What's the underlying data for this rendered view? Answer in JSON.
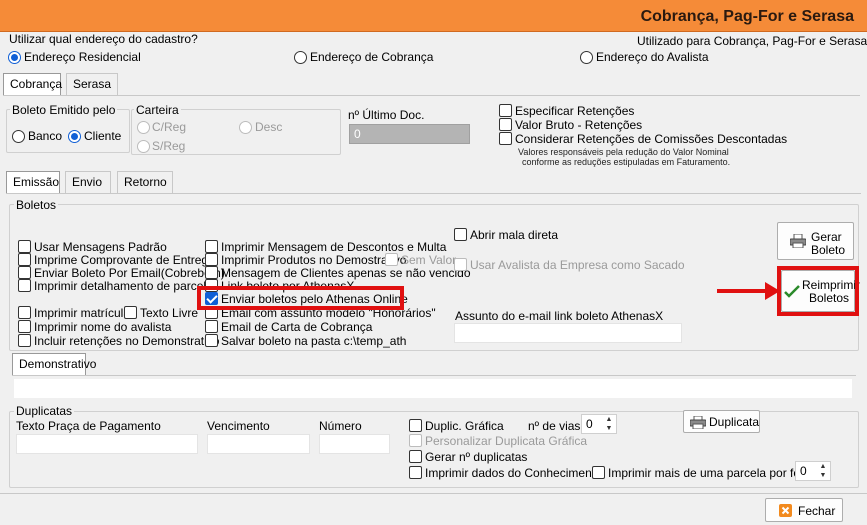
{
  "window": {
    "title": "Cobrança, Pag-For e Serasa"
  },
  "address": {
    "question": "Utilizar qual endereço do cadastro?",
    "note": "Utilizado para Cobrança, Pag-For e Serasa",
    "options": [
      "Endereço Residencial",
      "Endereço de Cobrança",
      "Endereço do Avalista"
    ],
    "selected": "Endereço Residencial"
  },
  "top_tabs": [
    "Cobrança",
    "Serasa"
  ],
  "boleto_emitido": {
    "title": "Boleto Emitido pelo",
    "options": [
      "Banco",
      "Cliente"
    ],
    "selected": "Cliente"
  },
  "carteira": {
    "title": "Carteira",
    "options": [
      "C/Reg",
      "Desc",
      "S/Reg"
    ]
  },
  "ultimo_doc": {
    "label": "nº Último Doc.",
    "value": "0"
  },
  "retencoes": {
    "items": [
      "Especificar Retenções",
      "Valor Bruto - Retenções",
      "Considerar Retenções de Comissões Descontadas"
    ],
    "note_line1": "Valores responsáveis pela redução do Valor Nominal",
    "note_line2": "conforme as reduções estipuladas em Faturamento."
  },
  "sub_tabs": [
    "Emissão",
    "Envio",
    "Retorno"
  ],
  "boletos": {
    "title": "Boletos",
    "col1": [
      "Usar Mensagens Padrão",
      "Imprime Comprovante de Entrega",
      "Enviar Boleto Por Email(Cobrebem)",
      "Imprimir detalhamento de parcela"
    ],
    "imprimir_matricula": "Imprimir matrícula",
    "texto_livre": "Texto Livre",
    "col1b": [
      "Imprimir nome do avalista",
      "Incluir retenções no Demonstrativo"
    ],
    "col2": [
      "Imprimir Mensagem de Descontos e Multa",
      "Imprimir Produtos no Demostrativo",
      "Mensagem de Clientes apenas se não vencido",
      "Link boleto por AthenasX"
    ],
    "sem_valor": "Sem Valor",
    "enviar_athenas": "Enviar boletos pelo Athenas Online",
    "col2b": [
      "Email com assunto modelo \"Honorários\"",
      "Email de Carta de Cobrança",
      "Salvar boleto na pasta c:\\temp_ath"
    ],
    "abrir_mala": "Abrir mala direta",
    "usar_avalista": "Usar Avalista da Empresa como Sacado",
    "assunto_label": "Assunto do e-mail link boleto AthenasX",
    "gerar_boleto_line1": "Gerar",
    "gerar_boleto_line2": "Boleto",
    "reimprimir_line1": "Reimprimir",
    "reimprimir_line2": "Boletos"
  },
  "demonstrativo": {
    "tab": "Demonstrativo"
  },
  "duplicatas": {
    "title": "Duplicatas",
    "texto_praca": "Texto Praça de Pagamento",
    "vencimento": "Vencimento",
    "numero": "Número",
    "duplic_grafica": "Duplic. Gráfica",
    "vias_label": "nº de vias",
    "vias_value": "0",
    "personalizar": "Personalizar Duplicata Gráfica",
    "gerar_duplicatas": "Gerar nº duplicatas",
    "imprimir_dados": "Imprimir dados do Conhecimento",
    "imprimir_mais": "Imprimir mais de uma parcela por folha",
    "mais_value": "0",
    "duplicata_button": "Duplicata"
  },
  "footer": {
    "fechar": "Fechar"
  },
  "colors": {
    "titlebar": "#f58b38",
    "highlight": "#e01010",
    "accent": "#0f5fd6"
  }
}
